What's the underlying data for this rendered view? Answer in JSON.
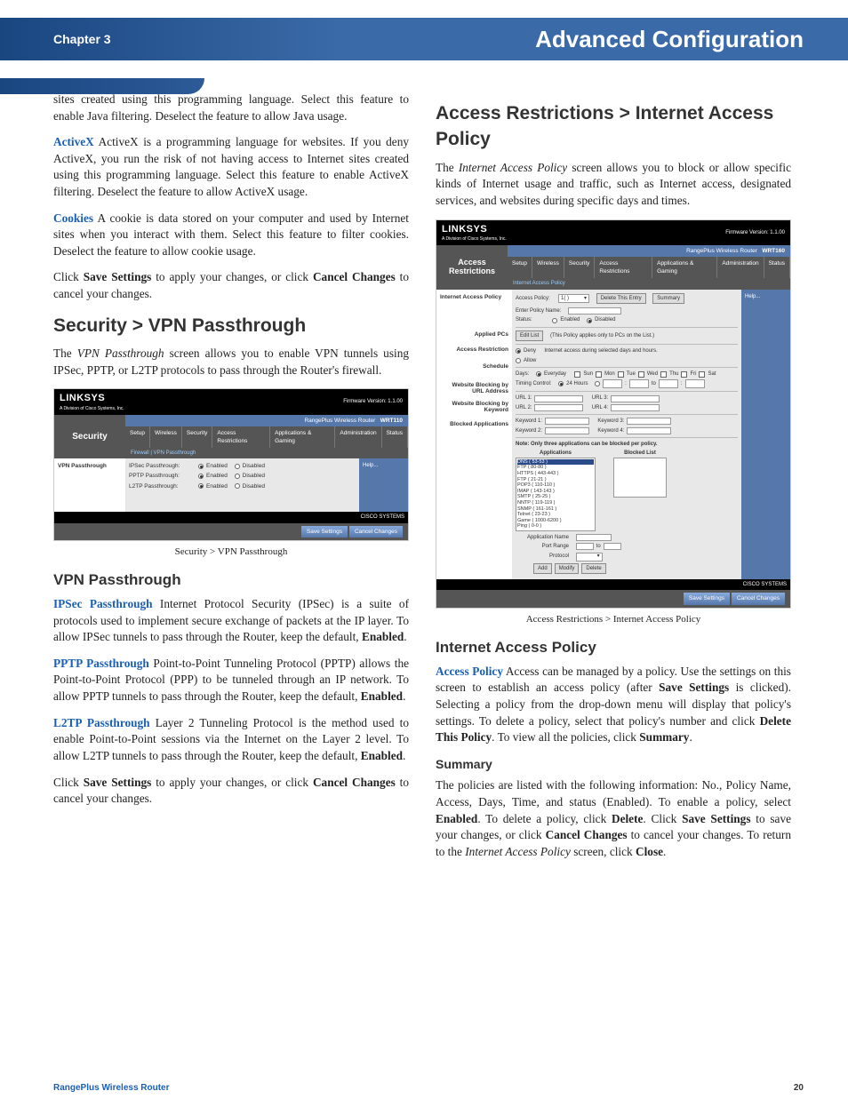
{
  "header": {
    "chapter": "Chapter 3",
    "title": "Advanced Configuration"
  },
  "left": {
    "p1": "sites created using this programming language. Select this feature to enable Java filtering. Deselect the feature to allow Java usage.",
    "activex_label": "ActiveX",
    "activex_body": "  ActiveX is a programming language for websites. If you deny ActiveX, you run the risk of not having access to Internet sites created using this programming language. Select this feature to enable ActiveX filtering. Deselect the feature to allow ActiveX usage.",
    "cookies_label": "Cookies",
    "cookies_body": "  A cookie is data stored on your computer and used by Internet sites when you interact with them. Select this feature to filter cookies. Deselect the feature to allow cookie usage.",
    "save1a": "Click ",
    "save1_bold1": "Save Settings",
    "save1b": " to apply your changes, or click ",
    "save1_bold2": "Cancel Changes",
    "save1c": " to cancel your changes.",
    "h1_vpn": "Security > VPN Passthrough",
    "vpn_intro_a": "The ",
    "vpn_intro_i": "VPN Passthrough",
    "vpn_intro_b": " screen allows you to enable VPN tunnels using IPSec, PPTP, or L2TP protocols to pass through the Router's firewall.",
    "fig1_caption": "Security > VPN Passthrough",
    "h2_vpn": "VPN Passthrough",
    "ipsec_label": "IPSec Passthrough",
    "ipsec_body_a": "  Internet Protocol Security (IPSec) is a suite of protocols used to implement secure exchange of packets at the IP layer. To allow IPSec tunnels to pass through the Router, keep the default, ",
    "ipsec_enabled": "Enabled",
    "period": ".",
    "pptp_label": "PPTP Passthrough",
    "pptp_body_a": "  Point-to-Point Tunneling Protocol (PPTP) allows the Point-to-Point Protocol (PPP) to be tunneled through an IP network. To allow PPTP tunnels to pass through the Router, keep the default, ",
    "pptp_enabled": "Enabled",
    "l2tp_label": "L2TP Passthrough",
    "l2tp_body_a": "  Layer 2 Tunneling Protocol is the method used to enable Point-to-Point sessions via the Internet on the Layer 2 level. To allow L2TP tunnels to pass through the Router, keep the default, ",
    "l2tp_enabled": "Enabled",
    "save2a": "Click ",
    "save2_bold1": "Save Settings",
    "save2b": " to apply your changes, or click ",
    "save2_bold2": "Cancel Changes",
    "save2c": " to cancel your changes."
  },
  "right": {
    "h1_access": "Access Restrictions > Internet Access Policy",
    "intro_a": "The ",
    "intro_i": "Internet Access Policy",
    "intro_b": " screen allows you to block or allow specific kinds of Internet usage and traffic, such as Internet access, designated services, and websites during specific days and times.",
    "fig2_caption": "Access Restrictions > Internet Access Policy",
    "h2_iap": "Internet Access Policy",
    "ap_label": "Access Policy",
    "ap_body_a": "  Access can be managed by a policy. Use the settings on this screen to establish an access policy (after ",
    "ap_save": "Save Settings",
    "ap_body_b": " is clicked). Selecting a policy from the drop-down menu will display that policy's settings. To delete a policy, select that policy's number and click ",
    "ap_delete": "Delete This Policy",
    "ap_body_c": ". To view all the policies, click ",
    "ap_summary": "Summary",
    "h3_summary": "Summary",
    "sum_a": "The policies are listed with the following information: No., Policy Name, Access, Days, Time, and status (Enabled). To enable a policy, select ",
    "sum_enabled": "Enabled",
    "sum_b": ". To delete a policy, click ",
    "sum_delete": "Delete",
    "sum_c": ". Click ",
    "sum_save": "Save Settings",
    "sum_d": " to save your changes, or click ",
    "sum_cancel": "Cancel Changes",
    "sum_e": " to cancel your changes. To return to the ",
    "sum_iap": "Internet Access Policy",
    "sum_f": " screen, click ",
    "sum_close": "Close"
  },
  "mock1": {
    "logo": "LINKSYS",
    "logo_sub": "A Division of Cisco Systems, Inc.",
    "fw": "Firmware Version: 1.1.00",
    "model_label": "RangePlus Wireless Router",
    "model": "WRT110",
    "section": "Security",
    "tabs": [
      "Setup",
      "Wireless",
      "Security",
      "Access Restrictions",
      "Applications & Gaming",
      "Administration",
      "Status"
    ],
    "subtab": "Firewall    |    VPN Passthrough",
    "side": "VPN Passthrough",
    "rows": [
      {
        "label": "IPSec Passthrough:",
        "en": "Enabled",
        "dis": "Disabled"
      },
      {
        "label": "PPTP Passthrough:",
        "en": "Enabled",
        "dis": "Disabled"
      },
      {
        "label": "L2TP Passthrough:",
        "en": "Enabled",
        "dis": "Disabled"
      }
    ],
    "help": "Help...",
    "save": "Save Settings",
    "cancel": "Cancel Changes",
    "cisco": "CISCO SYSTEMS"
  },
  "mock2": {
    "logo": "LINKSYS",
    "fw": "Firmware Version: 1.1.00",
    "model_label": "RangePlus Wireless Router",
    "model": "WRT160",
    "section": "Access Restrictions",
    "tabs": [
      "Setup",
      "Wireless",
      "Security",
      "Access Restrictions",
      "Applications & Gaming",
      "Administration",
      "Status"
    ],
    "subtab": "Internet Access Policy",
    "side1": "Internet Access Policy",
    "ap_label": "Access Policy:",
    "ap_value": "1( )",
    "btn_delete": "Delete This Entry",
    "btn_summary": "Summary",
    "policy_name": "Enter Policy Name:",
    "status": "Status:",
    "enabled": "Enabled",
    "disabled": "Disabled",
    "side2": "Applied PCs",
    "edit_list": "Edit List",
    "edit_note": "(This Policy applies only to PCs on the List.)",
    "side3": "Access Restriction",
    "deny": "Deny",
    "allow": "Allow",
    "deny_note": "Internet access during selected days and hours.",
    "side4": "Schedule",
    "days": "Days:",
    "everyday": "Everyday",
    "dlist": [
      "Sun",
      "Mon",
      "Tue",
      "Wed",
      "Thu",
      "Fri",
      "Sat"
    ],
    "timing": "Timing Control:",
    "t24": "24 Hours",
    "to": "to",
    "side5": "Website Blocking by URL Address",
    "url1": "URL 1:",
    "url2": "URL 2:",
    "url3": "URL 3:",
    "url4": "URL 4:",
    "side6": "Website Blocking by Keyword",
    "kw1": "Keyword 1:",
    "kw2": "Keyword 2:",
    "kw3": "Keyword 3:",
    "kw4": "Keyword 4:",
    "side7": "Blocked Applications",
    "note": "Note: Only three applications can be blocked per policy.",
    "apps_label": "Applications",
    "blocked_label": "Blocked List",
    "apps": [
      "DNS ( 53-53 )",
      "FTP ( 80-80 )",
      "HTTPS ( 443-443 )",
      "FTP ( 21-21 )",
      "POP3 ( 110-110 )",
      "IMAP ( 143-143 )",
      "SMTP ( 25-25 )",
      "NNTP ( 119-119 )",
      "SNMP ( 161-161 )",
      "Telnet ( 23-23 )",
      "Game ( 1000-6200 )",
      "Ping ( 0-0 )"
    ],
    "app_name": "Application Name",
    "port_range": "Port Range",
    "protocol": "Protocol",
    "help": "Help...",
    "save": "Save Settings",
    "cancel": "Cancel Changes"
  },
  "footer": {
    "product": "RangePlus Wireless Router",
    "page": "20"
  }
}
